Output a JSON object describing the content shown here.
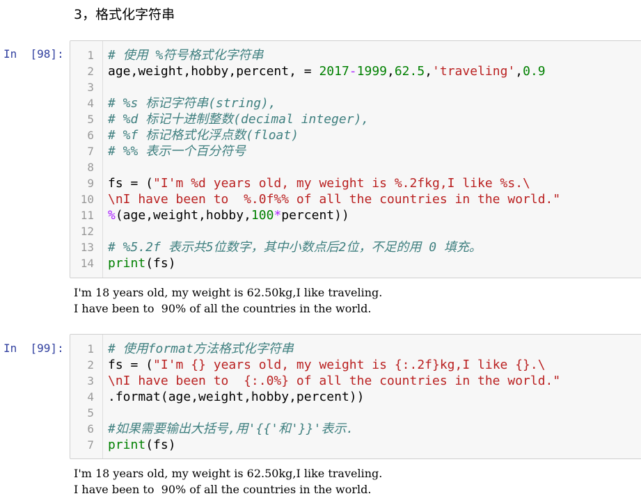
{
  "heading": "3，格式化字符串",
  "cells": [
    {
      "prompt": "In  [98]:",
      "lines": [
        {
          "n": "1",
          "tokens": [
            {
              "t": "# 使用 %符号格式化字符串",
              "k": "c"
            }
          ]
        },
        {
          "n": "2",
          "tokens": [
            {
              "t": "age,weight,hobby,percent, = ",
              "k": ""
            },
            {
              "t": "2017",
              "k": "n"
            },
            {
              "t": "-",
              "k": "o"
            },
            {
              "t": "1999",
              "k": "n"
            },
            {
              "t": ",",
              "k": ""
            },
            {
              "t": "62.5",
              "k": "n"
            },
            {
              "t": ",",
              "k": ""
            },
            {
              "t": "'traveling'",
              "k": "s"
            },
            {
              "t": ",",
              "k": ""
            },
            {
              "t": "0.9",
              "k": "n"
            }
          ]
        },
        {
          "n": "3",
          "tokens": []
        },
        {
          "n": "4",
          "tokens": [
            {
              "t": "# %s 标记字符串(string),",
              "k": "c"
            }
          ]
        },
        {
          "n": "5",
          "tokens": [
            {
              "t": "# %d 标记十进制整数(decimal integer),",
              "k": "c"
            }
          ]
        },
        {
          "n": "6",
          "tokens": [
            {
              "t": "# %f 标记格式化浮点数(float)",
              "k": "c"
            }
          ]
        },
        {
          "n": "7",
          "tokens": [
            {
              "t": "# %% 表示一个百分符号",
              "k": "c"
            }
          ]
        },
        {
          "n": "8",
          "tokens": []
        },
        {
          "n": "9",
          "tokens": [
            {
              "t": "fs = (",
              "k": ""
            },
            {
              "t": "\"I'm %d years old, my weight is %.2fkg,I like %s.\\",
              "k": "s"
            }
          ]
        },
        {
          "n": "10",
          "tokens": [
            {
              "t": "\\nI have been to  %.0f%% of all the countries in the world.\"",
              "k": "s"
            }
          ]
        },
        {
          "n": "11",
          "tokens": [
            {
              "t": "%",
              "k": "o"
            },
            {
              "t": "(age,weight,hobby,",
              "k": ""
            },
            {
              "t": "100",
              "k": "n"
            },
            {
              "t": "*",
              "k": "o"
            },
            {
              "t": "percent))",
              "k": ""
            }
          ]
        },
        {
          "n": "12",
          "tokens": []
        },
        {
          "n": "13",
          "tokens": [
            {
              "t": "# %5.2f 表示共5位数字，其中小数点后2位，不足的用 0 填充。",
              "k": "c"
            }
          ]
        },
        {
          "n": "14",
          "tokens": [
            {
              "t": "print",
              "k": "f"
            },
            {
              "t": "(fs)",
              "k": ""
            }
          ]
        }
      ],
      "output": [
        "I'm 18 years old, my weight is 62.50kg,I like traveling.",
        "I have been to  90% of all the countries in the world."
      ]
    },
    {
      "prompt": "In  [99]:",
      "lines": [
        {
          "n": "1",
          "tokens": [
            {
              "t": "# 使用format方法格式化字符串",
              "k": "c"
            }
          ]
        },
        {
          "n": "2",
          "tokens": [
            {
              "t": "fs = (",
              "k": ""
            },
            {
              "t": "\"I'm {} years old, my weight is {:.2f}kg,I like {}.\\",
              "k": "s"
            }
          ]
        },
        {
          "n": "3",
          "tokens": [
            {
              "t": "\\nI have been to  {:.0%} of all the countries in the world.\"",
              "k": "s"
            }
          ]
        },
        {
          "n": "4",
          "tokens": [
            {
              "t": ".format(age,weight,hobby,percent))",
              "k": ""
            }
          ]
        },
        {
          "n": "5",
          "tokens": []
        },
        {
          "n": "6",
          "tokens": [
            {
              "t": "#如果需要输出大括号,用'{{'和'}}'表示.",
              "k": "c"
            }
          ]
        },
        {
          "n": "7",
          "tokens": [
            {
              "t": "print",
              "k": "f"
            },
            {
              "t": "(fs)",
              "k": ""
            }
          ]
        }
      ],
      "output": [
        "I'm 18 years old, my weight is 62.50kg,I like traveling.",
        "I have been to  90% of all the countries in the world."
      ]
    }
  ]
}
